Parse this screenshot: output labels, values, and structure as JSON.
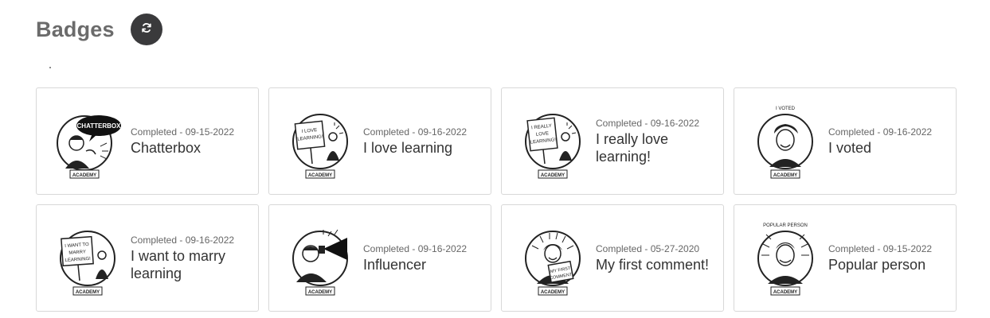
{
  "page": {
    "title": "Badges"
  },
  "refresh_icon": "refresh-icon",
  "badges": [
    {
      "status": "Completed - 09-15-2022",
      "name": "Chatterbox",
      "sign": "CHATTERBOX",
      "icon": "chatterbox-badge-icon"
    },
    {
      "status": "Completed - 09-16-2022",
      "name": "I love learning",
      "sign": "I LOVE LEARNING!",
      "icon": "i-love-learning-badge-icon"
    },
    {
      "status": "Completed - 09-16-2022",
      "name": "I really love learning!",
      "sign": "I REALLY LOVE LEARNING!",
      "icon": "i-really-love-learning-badge-icon"
    },
    {
      "status": "Completed - 09-16-2022",
      "name": "I voted",
      "sign": "I VOTED",
      "icon": "i-voted-badge-icon"
    },
    {
      "status": "Completed - 09-16-2022",
      "name": "I want to marry learning",
      "sign": "I WANT TO MARRY LEARNING!",
      "icon": "i-want-to-marry-learning-badge-icon"
    },
    {
      "status": "Completed - 09-16-2022",
      "name": "Influencer",
      "sign": "",
      "icon": "influencer-badge-icon"
    },
    {
      "status": "Completed - 05-27-2020",
      "name": "My first comment!",
      "sign": "MY FIRST COMMENT!",
      "icon": "my-first-comment-badge-icon"
    },
    {
      "status": "Completed - 09-15-2022",
      "name": "Popular person",
      "sign": "POPULAR PERSON",
      "icon": "popular-person-badge-icon"
    }
  ],
  "badge_footer": "ACADEMY"
}
